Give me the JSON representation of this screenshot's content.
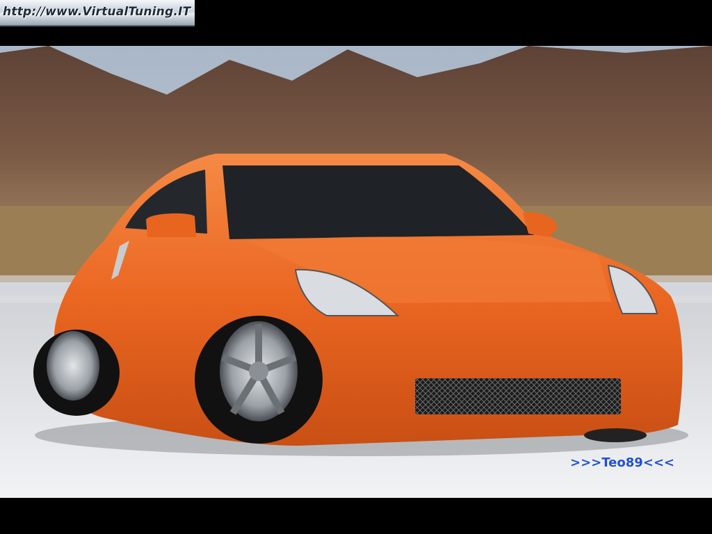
{
  "banner": {
    "url_text": "http://www.VirtualTuning.IT"
  },
  "photo": {
    "subject": "orange sports coupe in salt flat desert with mountains",
    "body_color": "#ee6a25",
    "sky_color": "#b8c6d4",
    "mountain_color": "#6e5040",
    "ground_color": "#e4e6ea"
  },
  "signature": {
    "text": ">>>Teo89<<<",
    "color": "#1e4fd6"
  }
}
